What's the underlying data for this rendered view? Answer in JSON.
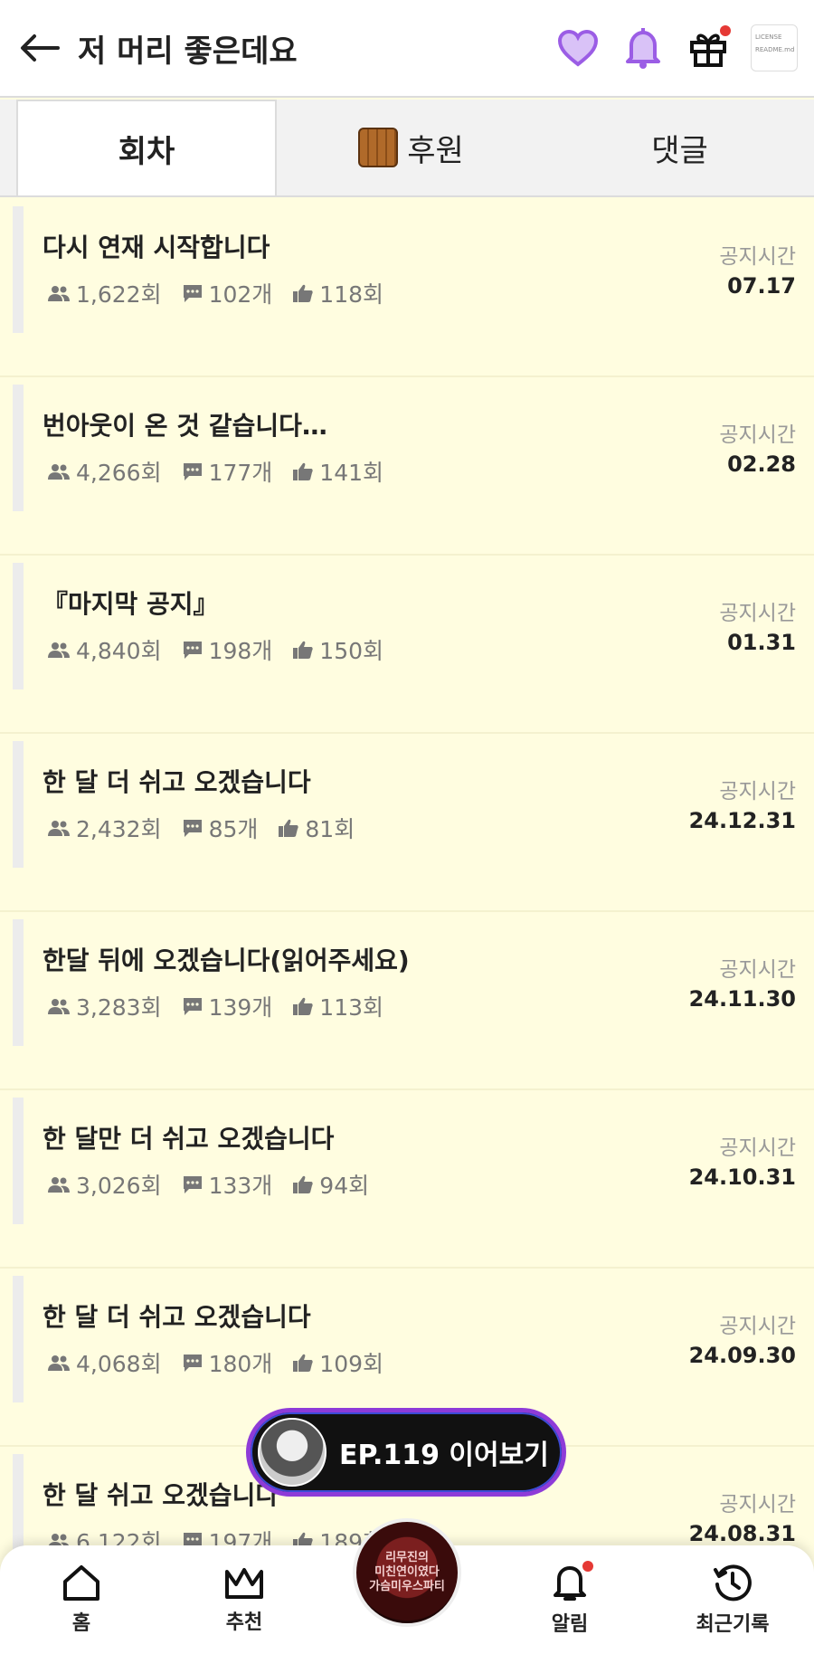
{
  "header": {
    "title": "저 머리 좋은데요",
    "thumb_lines": [
      "LICENSE",
      "README.md"
    ]
  },
  "tabs": [
    {
      "label": "회차"
    },
    {
      "label": "후원"
    },
    {
      "label": "댓글"
    }
  ],
  "notice_label": "공지시간",
  "items": [
    {
      "title": "다시 연재 시작합니다",
      "views": "1,622회",
      "comments": "102개",
      "likes": "118회",
      "date": "07.17"
    },
    {
      "title": "번아웃이 온 것 같습니다…",
      "views": "4,266회",
      "comments": "177개",
      "likes": "141회",
      "date": "02.28"
    },
    {
      "title": "『마지막 공지』",
      "views": "4,840회",
      "comments": "198개",
      "likes": "150회",
      "date": "01.31"
    },
    {
      "title": "한 달 더 쉬고 오겠습니다",
      "views": "2,432회",
      "comments": "85개",
      "likes": "81회",
      "date": "24.12.31"
    },
    {
      "title": "한달 뒤에 오겠습니다(읽어주세요)",
      "views": "3,283회",
      "comments": "139개",
      "likes": "113회",
      "date": "24.11.30"
    },
    {
      "title": "한 달만 더 쉬고 오겠습니다",
      "views": "3,026회",
      "comments": "133개",
      "likes": "94회",
      "date": "24.10.31"
    },
    {
      "title": "한 달 더 쉬고 오겠습니다",
      "views": "4,068회",
      "comments": "180개",
      "likes": "109회",
      "date": "24.09.30"
    },
    {
      "title": "한 달 쉬고 오겠습니다",
      "views": "6,122회",
      "comments": "197개",
      "likes": "189회",
      "date": "24.08.31"
    }
  ],
  "continue_button": {
    "label": "EP.119 이어보기"
  },
  "bottom_nav": {
    "home": "홈",
    "recommend": "추천",
    "center_badge_lines": [
      "리무진의",
      "미친연이였다",
      "가슴미우스파티"
    ],
    "alerts": "알림",
    "recent": "최근기록"
  },
  "colors": {
    "accent": "#9b5de5",
    "background": "#fffde0",
    "alert_dot": "#e53935"
  },
  "icons": [
    "back-arrow-icon",
    "heart-icon",
    "bell-icon",
    "gift-icon",
    "people-icon",
    "comment-icon",
    "thumbs-up-icon",
    "home-icon",
    "crown-icon",
    "clock-icon"
  ]
}
